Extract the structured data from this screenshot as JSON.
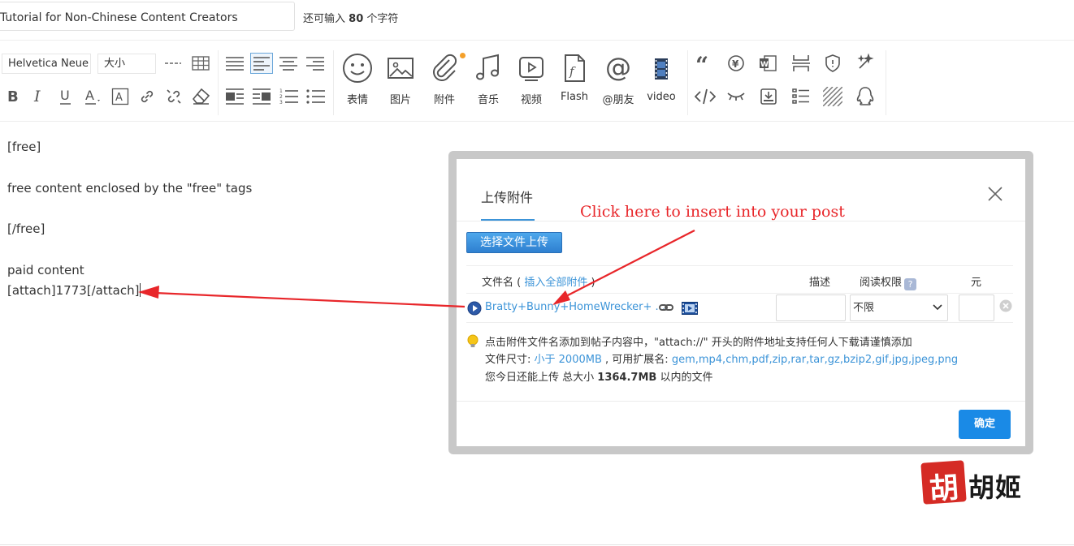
{
  "title_bar": {
    "title_value": "Tutorial for Non-Chinese Content Creators",
    "count_prefix": "还可输入",
    "count_value": "80",
    "count_suffix": "个字符"
  },
  "toolbar": {
    "font_family": "Helvetica Neue",
    "font_size": "大小",
    "icons_row1": [
      "horizontal-rule-icon",
      "table-icon",
      "justify-icon",
      "align-left-icon",
      "align-center-icon",
      "align-right-icon"
    ],
    "icons_row2": [
      "bold-icon",
      "italic-icon",
      "underline-icon",
      "font-color-icon",
      "background-color-icon",
      "link-icon",
      "unlink-icon",
      "eraser-icon",
      "float-left-icon",
      "float-right-icon",
      "ordered-list-icon",
      "unordered-list-icon"
    ],
    "media": [
      {
        "icon": "smiley-icon",
        "label": "表情"
      },
      {
        "icon": "image-icon",
        "label": "图片"
      },
      {
        "icon": "paperclip-icon",
        "label": "附件"
      },
      {
        "icon": "music-icon",
        "label": "音乐"
      },
      {
        "icon": "video-icon",
        "label": "视频"
      },
      {
        "icon": "flash-icon",
        "label": "Flash"
      },
      {
        "icon": "at-icon",
        "label": "@朋友"
      },
      {
        "icon": "film-icon",
        "label": "video"
      }
    ],
    "extra_icons": [
      "quote-icon",
      "currency-icon",
      "word-icon",
      "page-break-icon",
      "shield-icon",
      "magic-icon",
      "code-icon",
      "hide-icon",
      "download-icon",
      "index-icon",
      "stripes-icon",
      "qq-icon"
    ],
    "attachment_dot_color": "#f4a02a"
  },
  "editor": {
    "lines": [
      "[free]",
      "free content enclosed by the \"free\" tags",
      "[/free]",
      "paid content",
      "[attach]1773[/attach]"
    ]
  },
  "dialog": {
    "title": "上传附件",
    "choose_button": "选择文件上传",
    "col_filename": "文件名",
    "insert_all": "插入全部附件",
    "col_desc": "描述",
    "col_perm": "阅读权限",
    "col_price": "元",
    "file_name": "Bratty+Bunny+HomeWrecker+ ...",
    "perm_value": "不限",
    "tip_line1": "点击附件文件名添加到帖子内容中，\"attach://\" 开头的附件地址支持任何人下载请谨慎添加",
    "tip_size_label": "文件尺寸:",
    "tip_size_value": "小于 2000MB",
    "tip_ext_label": ", 可用扩展名:",
    "tip_ext_value": "gem,mp4,chm,pdf,zip,rar,tar,gz,bzip2,gif,jpg,jpeg,png",
    "tip_today_prefix": "您今日还能上传 总大小",
    "tip_today_value": "1364.7MB",
    "tip_today_suffix": "以内的文件",
    "ok_button": "确定",
    "accent_color": "#1a8ae6"
  },
  "annotation": {
    "text": "Click here to insert into your post",
    "color": "#e8262a"
  },
  "watermark": {
    "seal_text": "胡",
    "name": "胡姬"
  }
}
